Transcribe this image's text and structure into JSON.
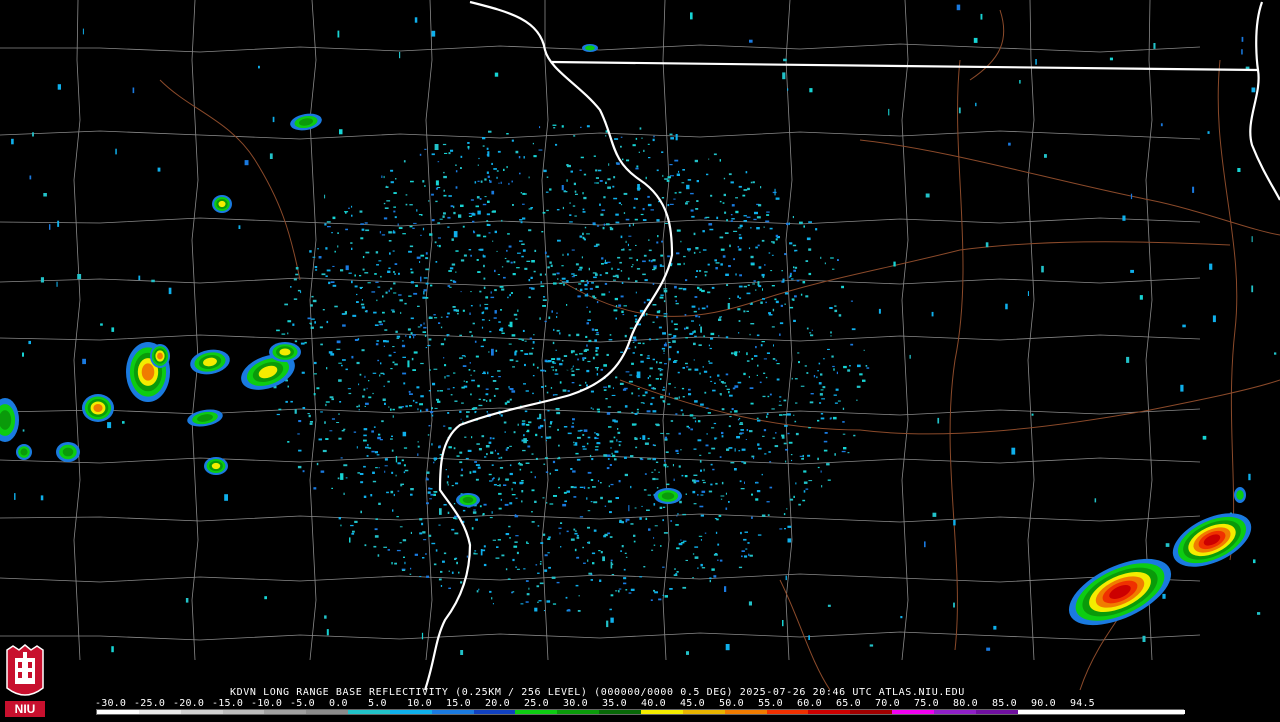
{
  "product_caption": "KDVN LONG RANGE BASE REFLECTIVITY (0.25KM / 256 LEVEL) (000000/0000 0.5 DEG) 2025-07-26 20:46 UTC  ATLAS.NIU.EDU",
  "logo": {
    "text": "NIU",
    "icon": "niu-logo-icon"
  },
  "colors": {
    "background": "#000000",
    "county_lines": "#8a8a8a",
    "state_lines": "#ffffff",
    "highways": "#8b4a2a"
  },
  "scale": {
    "labels": [
      "-30.0",
      "-25.0",
      "-20.0",
      "-15.0",
      "-10.0",
      "-5.0",
      "0.0",
      "5.0",
      "10.0",
      "15.0",
      "20.0",
      "25.0",
      "30.0",
      "35.0",
      "40.0",
      "45.0",
      "50.0",
      "55.0",
      "60.0",
      "65.0",
      "70.0",
      "75.0",
      "80.0",
      "85.0",
      "90.0",
      "94.5"
    ],
    "colors": [
      "#ffffff",
      "#e8e8e8",
      "#d0d0d0",
      "#bbbbbb",
      "#a0a0a0",
      "#8c8c8c",
      "#22c2c9",
      "#0fb0ec",
      "#1a7ae0",
      "#1040c0",
      "#0dcc12",
      "#0a9a0a",
      "#086808",
      "#f4ec00",
      "#e8b400",
      "#f07c00",
      "#f03000",
      "#cc0000",
      "#a00000",
      "#f000f0",
      "#9020c8",
      "#7010a0",
      "#ffffff",
      "#ffffff",
      "#ffffff",
      "#ffffff"
    ]
  }
}
